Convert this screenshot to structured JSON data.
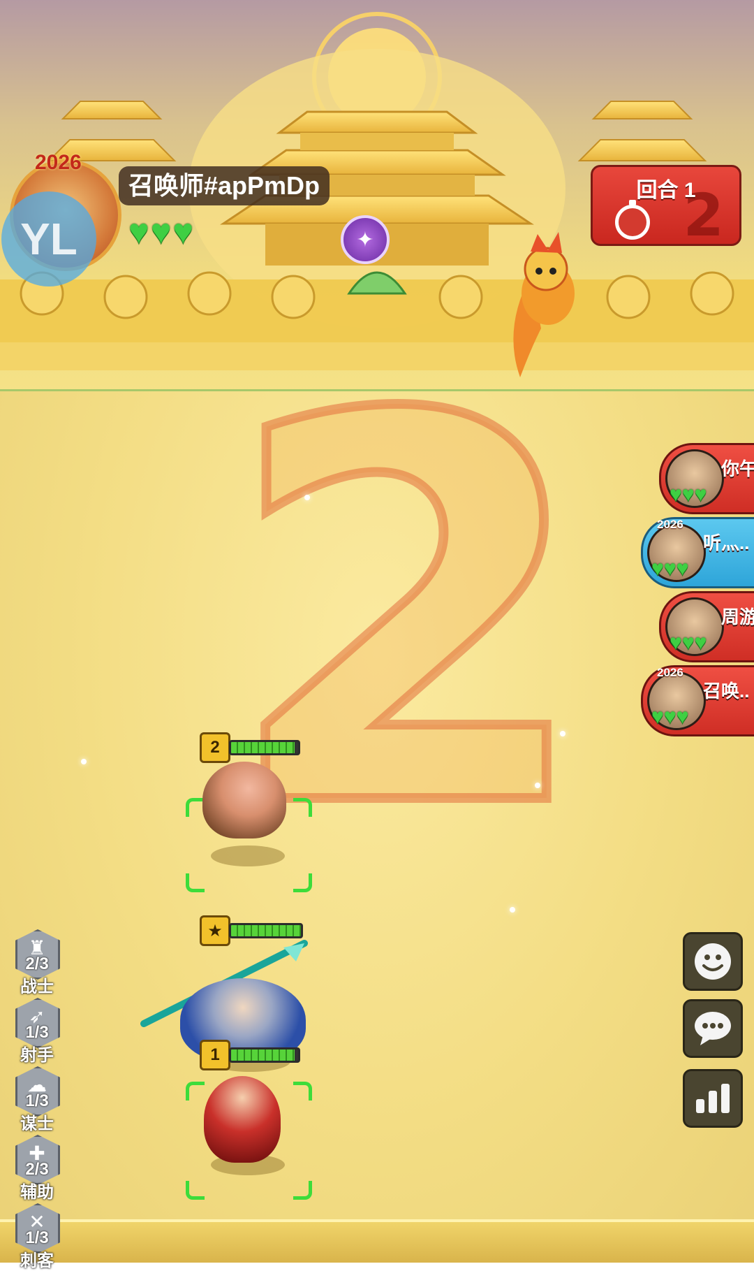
{
  "player": {
    "name": "召唤师#apPmDp",
    "year_badge": "2026",
    "logo_text": "YL",
    "hearts": [
      "♥",
      "♥",
      "♥"
    ]
  },
  "round": {
    "label": "回合 1",
    "countdown": "2"
  },
  "center_countdown": "2",
  "opponents": [
    {
      "name": "你午",
      "hearts": "♥♥♥",
      "year": ""
    },
    {
      "name": "听灬..",
      "hearts": "♥♥♥",
      "year": "2026"
    },
    {
      "name": "周游",
      "hearts": "♥♥♥",
      "year": ""
    },
    {
      "name": "召唤..",
      "hearts": "♥♥♥",
      "year": "2026"
    }
  ],
  "units": [
    {
      "level": "2",
      "hp_fraction": 0.95
    },
    {
      "level": "★",
      "hp_fraction": 1.0
    },
    {
      "level": "1",
      "hp_fraction": 0.95
    }
  ],
  "roles": [
    {
      "icon": "sword-icon",
      "glyph": "♜",
      "count": "2/3",
      "label": "战士"
    },
    {
      "icon": "bow-icon",
      "glyph": "➶",
      "count": "1/3",
      "label": "射手"
    },
    {
      "icon": "scroll-icon",
      "glyph": "☁",
      "count": "1/3",
      "label": "谋士"
    },
    {
      "icon": "plus-icon",
      "glyph": "✚",
      "count": "2/3",
      "label": "辅助"
    },
    {
      "icon": "dagger-icon",
      "glyph": "✕",
      "count": "1/3",
      "label": "刺客"
    }
  ],
  "actions": [
    {
      "icon": "emoji-icon"
    },
    {
      "icon": "chat-icon"
    },
    {
      "icon": "stats-icon"
    }
  ],
  "colors": {
    "heart": "#3fcf43",
    "round_box": "#d8342b",
    "opponent_active": "#3ab3e3",
    "selection": "#3ddc3a"
  }
}
